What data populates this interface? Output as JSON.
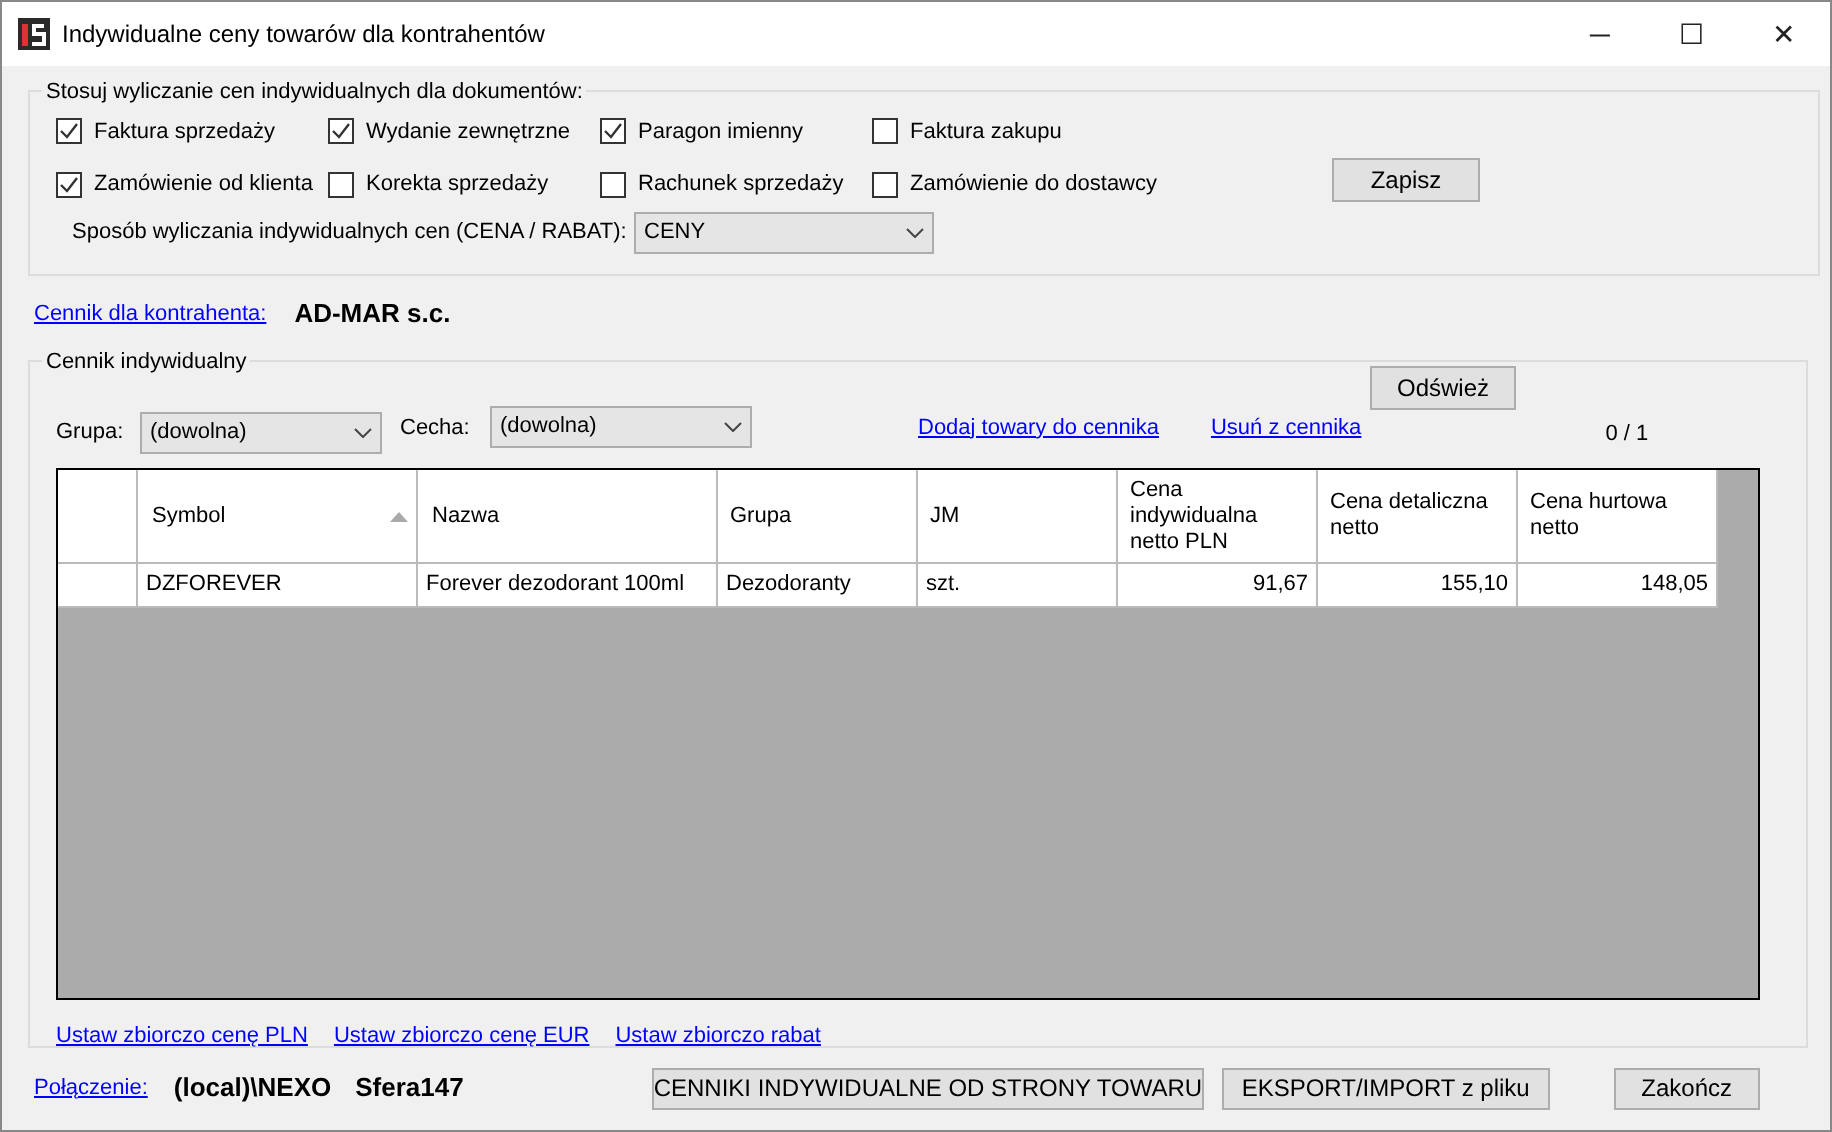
{
  "window": {
    "title": "Indywidualne ceny towarów dla kontrahentów",
    "controls": [
      "─",
      "☐",
      "✕"
    ]
  },
  "documents_group": {
    "legend": "Stosuj wyliczanie cen indywidualnych dla dokumentów:",
    "checkboxes": [
      {
        "label": "Faktura sprzedaży",
        "checked": true
      },
      {
        "label": "Wydanie zewnętrzne",
        "checked": true
      },
      {
        "label": "Paragon imienny",
        "checked": true
      },
      {
        "label": "Faktura zakupu",
        "checked": false
      },
      {
        "label": "Zamówienie od klienta",
        "checked": true
      },
      {
        "label": "Korekta sprzedaży",
        "checked": false
      },
      {
        "label": "Rachunek sprzedaży",
        "checked": false
      },
      {
        "label": "Zamówienie do dostawcy",
        "checked": false
      }
    ],
    "save_button": "Zapisz",
    "method_label": "Sposób wyliczania indywidualnych cen (CENA / RABAT):",
    "method_value": "CENY"
  },
  "contractor": {
    "link": "Cennik dla kontrahenta:",
    "name": "AD-MAR s.c."
  },
  "pricelist_group": {
    "legend": "Cennik indywidualny",
    "refresh_button": "Odśwież",
    "group_label": "Grupa:",
    "group_value": "(dowolna)",
    "feature_label": "Cecha:",
    "feature_value": "(dowolna)",
    "links": [
      "Dodaj towary do cennika",
      "Usuń z cennika"
    ],
    "counter": "0 / 1",
    "table": {
      "columns": [
        {
          "label": "Symbol",
          "sorted": true
        },
        {
          "label": "Nazwa",
          "sorted": false
        },
        {
          "label": "Grupa",
          "sorted": false
        },
        {
          "label": "JM",
          "sorted": false
        },
        {
          "label": "Cena indywidualna netto PLN",
          "sorted": false
        },
        {
          "label": "Cena detaliczna netto",
          "sorted": false
        },
        {
          "label": "Cena hurtowa netto",
          "sorted": false
        }
      ],
      "rows": [
        {
          "cells": [
            "DZFOREVER",
            "Forever dezodorant 100ml",
            "Dezodoranty",
            "szt.",
            "91,67",
            "155,10",
            "148,05"
          ]
        }
      ]
    },
    "bottom_links": [
      "Ustaw zbiorczo cenę PLN",
      "Ustaw zbiorczo cenę EUR",
      "Ustaw zbiorczo rabat"
    ]
  },
  "footer": {
    "connection_link": "Połączenie:",
    "server": "(local)\\NEXO",
    "database": "Sfera147",
    "buttons": [
      "CENNIKI INDYWIDUALNE OD STRONY TOWARU",
      "EKSPORT/IMPORT z pliku",
      "Zakończ"
    ]
  }
}
